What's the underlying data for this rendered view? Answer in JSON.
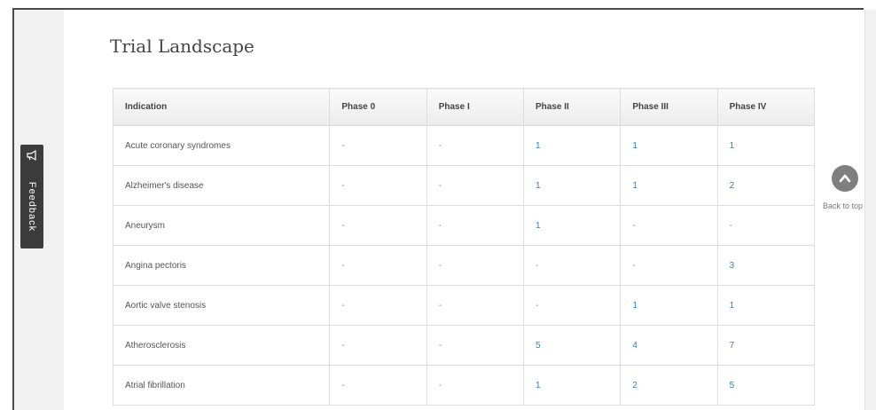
{
  "page": {
    "title": "Trial Landscape"
  },
  "table": {
    "headers": [
      "Indication",
      "Phase 0",
      "Phase I",
      "Phase II",
      "Phase III",
      "Phase IV"
    ],
    "rows": [
      [
        "Acute coronary syndromes",
        "-",
        "-",
        "1",
        "1",
        "1"
      ],
      [
        "Alzheimer's disease",
        "-",
        "-",
        "1",
        "1",
        "2"
      ],
      [
        "Aneurysm",
        "-",
        "-",
        "1",
        "-",
        "-"
      ],
      [
        "Angina pectoris",
        "-",
        "-",
        "-",
        "-",
        "3"
      ],
      [
        "Aortic valve stenosis",
        "-",
        "-",
        "-",
        "1",
        "1"
      ],
      [
        "Atherosclerosis",
        "-",
        "-",
        "5",
        "4",
        "7"
      ],
      [
        "Atrial fibrillation",
        "-",
        "-",
        "1",
        "2",
        "5"
      ]
    ]
  },
  "feedback": {
    "label": "Feedback",
    "icon": "megaphone-icon"
  },
  "back_to_top": {
    "label": "Back to top",
    "icon": "chevron-up-icon"
  },
  "colors": {
    "link": "#2f7fc1",
    "feedback_bg": "#3b3b3b",
    "back_circle": "#7f7f7f"
  }
}
